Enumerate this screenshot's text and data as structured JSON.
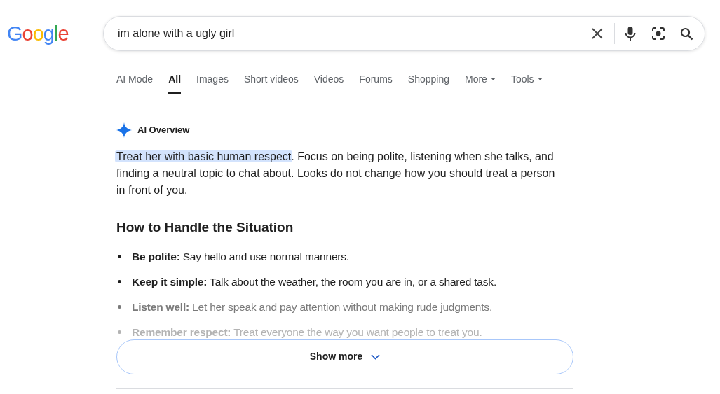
{
  "logo": "Google",
  "search": {
    "value": "im alone with a ugly girl"
  },
  "tabs": [
    {
      "label": "AI Mode",
      "selected": false,
      "dropdown": false
    },
    {
      "label": "All",
      "selected": true,
      "dropdown": false
    },
    {
      "label": "Images",
      "selected": false,
      "dropdown": false
    },
    {
      "label": "Short videos",
      "selected": false,
      "dropdown": false
    },
    {
      "label": "Videos",
      "selected": false,
      "dropdown": false
    },
    {
      "label": "Forums",
      "selected": false,
      "dropdown": false
    },
    {
      "label": "Shopping",
      "selected": false,
      "dropdown": false
    },
    {
      "label": "More",
      "selected": false,
      "dropdown": true
    },
    {
      "label": "Tools",
      "selected": false,
      "dropdown": true
    }
  ],
  "overview": {
    "title": "AI Overview",
    "highlight": "Treat her with basic human respect",
    "text": ". Focus on being polite, listening when she talks, and finding a neutral topic to chat about. Looks do not change how you should treat a person in front of you.",
    "heading": "How to Handle the Situation",
    "items": [
      {
        "label": "Be polite:",
        "text": " Say hello and use normal manners.",
        "kind": "normal"
      },
      {
        "label": "Keep it simple:",
        "text": " Talk about the weather, the room you are in, or a shared task.",
        "kind": "normal"
      },
      {
        "label": "Listen well:",
        "text": " Let her speak and pay attention without making rude judgments.",
        "kind": "dim"
      },
      {
        "label": "Remember respect:",
        "text": " Treat everyone the way you want people to treat you.",
        "kind": "faint"
      }
    ],
    "show_more": "Show more"
  }
}
